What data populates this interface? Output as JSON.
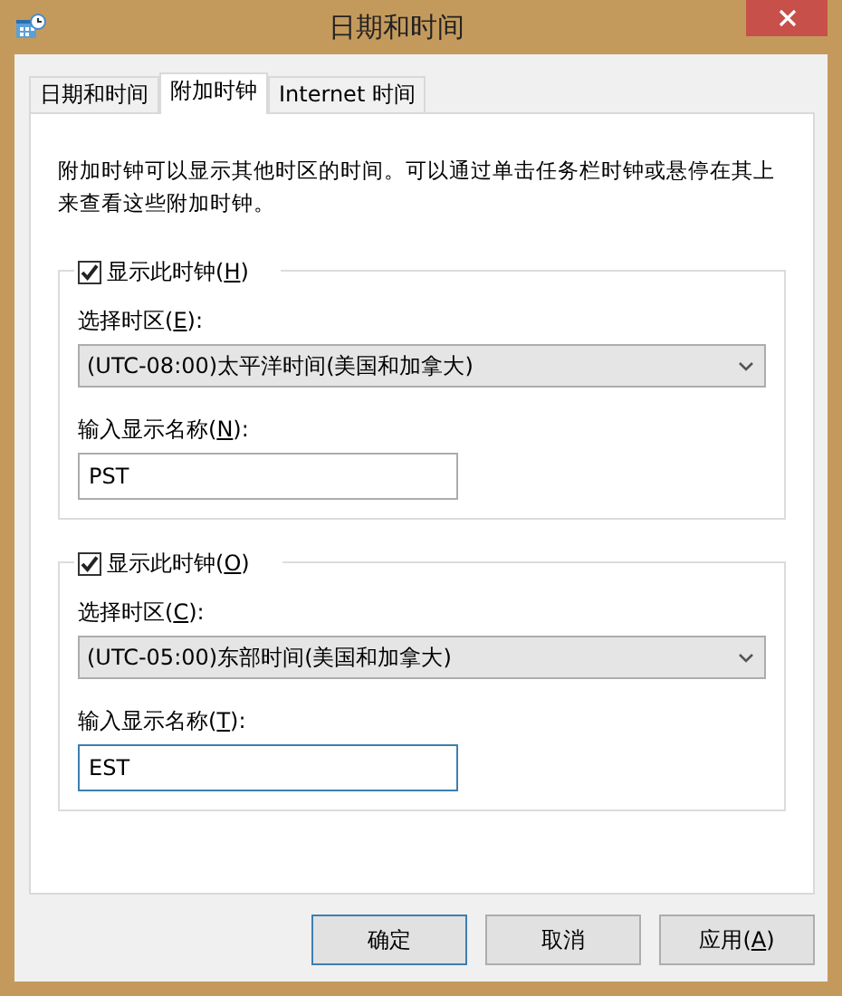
{
  "window": {
    "title": "日期和时间"
  },
  "tabs": [
    {
      "label": "日期和时间",
      "selected": false
    },
    {
      "label": "附加时钟",
      "selected": true
    },
    {
      "label": "Internet 时间",
      "selected": false
    }
  ],
  "description": "附加时钟可以显示其他时区的时间。可以通过单击任务栏时钟或悬停在其上来查看这些附加时钟。",
  "clocks": [
    {
      "show": {
        "label": "显示此时钟(",
        "access_key": "H",
        "label_end": ")",
        "checked": true
      },
      "zone_label": {
        "label": "选择时区(",
        "access_key": "E",
        "label_end": "):"
      },
      "zone": "(UTC-08:00)太平洋时间(美国和加拿大)",
      "name_label": {
        "label": "输入显示名称(",
        "access_key": "N",
        "label_end": "):"
      },
      "name": {
        "value": "PST",
        "focused": false
      }
    },
    {
      "show": {
        "label": "显示此时钟(",
        "access_key": "O",
        "label_end": ")",
        "checked": true
      },
      "zone_label": {
        "label": "选择时区(",
        "access_key": "C",
        "label_end": "):"
      },
      "zone": "(UTC-05:00)东部时间(美国和加拿大)",
      "name_label": {
        "label": "输入显示名称(",
        "access_key": "T",
        "label_end": "):"
      },
      "name": {
        "value": "EST",
        "focused": true
      }
    }
  ],
  "buttons": [
    {
      "label": "确定",
      "default": true
    },
    {
      "label": "取消",
      "default": false
    },
    {
      "label": "应用(",
      "access_key": "A",
      "label_end": ")",
      "default": false
    }
  ]
}
